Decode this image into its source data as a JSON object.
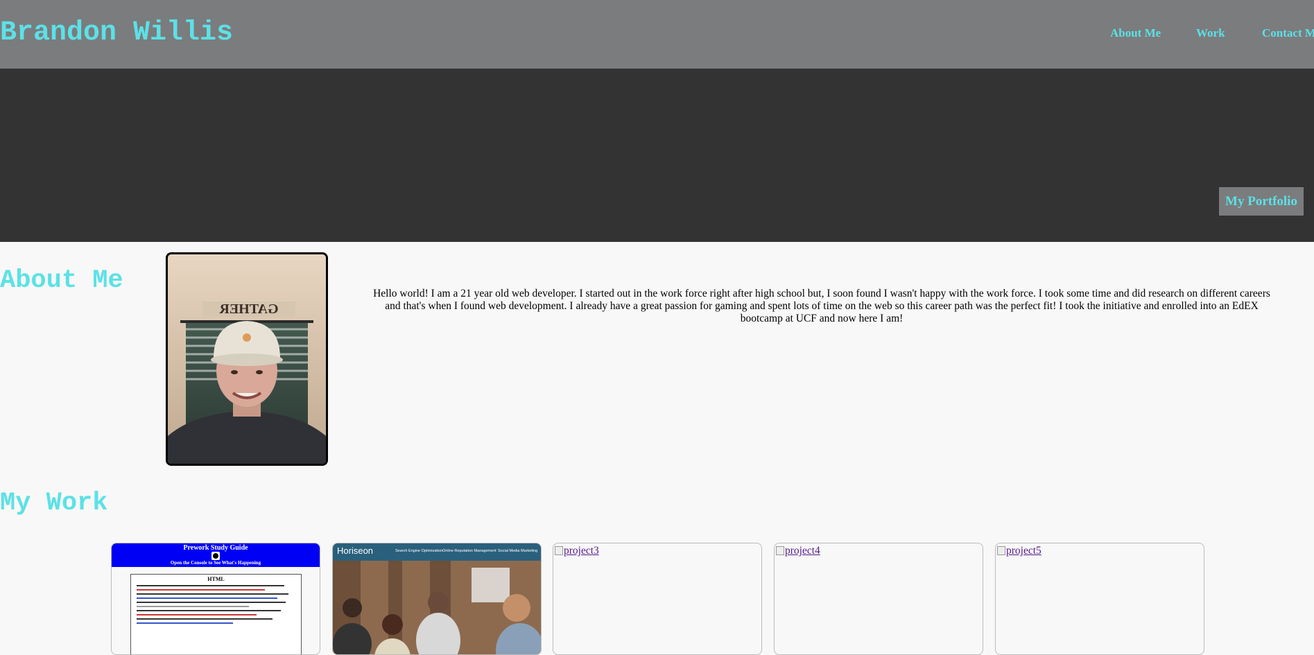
{
  "header": {
    "title": "Brandon Willis",
    "nav": [
      {
        "label": "About Me"
      },
      {
        "label": "Work"
      },
      {
        "label": "Contact Me"
      }
    ],
    "bg_color": "#7b7c7e",
    "accent_color": "#5ce1e6"
  },
  "hero": {
    "button_label": "My Portfolio",
    "bg_color": "#333333"
  },
  "about": {
    "heading": "About Me",
    "photo_sign": "GATHER",
    "text": "Hello world! I am a 21 year old web developer. I started out in the work force right after high school but, I soon found I wasn't happy with the work force. I took some time and did research on different careers and that's when I found web development. I already have a great passion for gaming and spent lots of time on the web so this career path was the perfect fit! I took the initiative and enrolled into an EdEX bootcamp at UCF and now here I am!"
  },
  "work": {
    "heading": "My Work",
    "projects": [
      {
        "title": "Prework Study Guide",
        "subtitle": "Open the Console to See What's Happening",
        "section": "HTML"
      },
      {
        "brand": "Horiseon",
        "nav": [
          "Search Engine Optimization",
          "Online Reputation Management",
          "Social Media Marketing"
        ]
      },
      {
        "alt": "project3"
      },
      {
        "alt": "project4"
      },
      {
        "alt": "project5"
      }
    ]
  }
}
